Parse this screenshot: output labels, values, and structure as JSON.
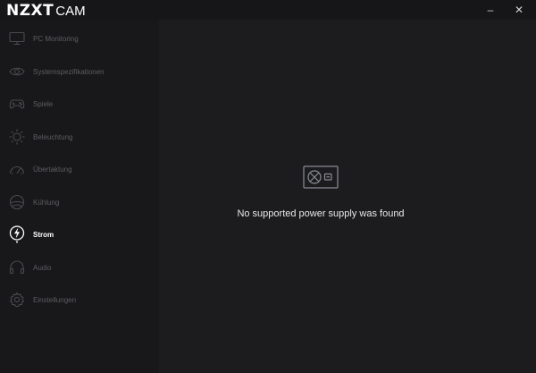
{
  "app": {
    "logo_bold": "NZXT",
    "logo_light": "CAM",
    "minimize_glyph": "–",
    "close_glyph": "✕"
  },
  "sidebar": {
    "items": [
      {
        "label": "PC Monitoring",
        "icon": "monitor-icon",
        "active": false
      },
      {
        "label": "Systemspezifikationen",
        "icon": "eye-icon",
        "active": false
      },
      {
        "label": "Spiele",
        "icon": "gamepad-icon",
        "active": false
      },
      {
        "label": "Beleuchtung",
        "icon": "sun-icon",
        "active": false
      },
      {
        "label": "Übertaktung",
        "icon": "speedometer-icon",
        "active": false
      },
      {
        "label": "Kühlung",
        "icon": "fan-icon",
        "active": false
      },
      {
        "label": "Strom",
        "icon": "power-bolt-icon",
        "active": true
      },
      {
        "label": "Audio",
        "icon": "headphones-icon",
        "active": false
      },
      {
        "label": "Einstellungen",
        "icon": "gear-icon",
        "active": false
      }
    ]
  },
  "main": {
    "message": "No supported power supply was found",
    "icon": "power-supply-icon"
  },
  "colors": {
    "background": "#151517",
    "sidebar": "#18181a",
    "content": "#1c1c1e",
    "inactive_text": "#5d5d62",
    "active_text": "#ffffff"
  }
}
